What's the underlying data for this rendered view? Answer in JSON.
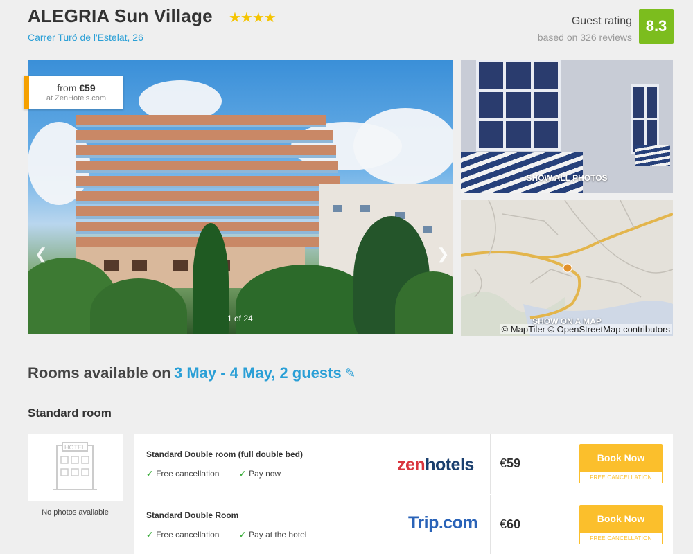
{
  "hotel": {
    "name": "ALEGRIA Sun Village",
    "stars": "★★★★",
    "star_count": 4,
    "address": "Carrer Turó de l'Estelat, 26"
  },
  "rating": {
    "label": "Guest rating",
    "sub": "based on 326 reviews",
    "score": "8.3",
    "color": "#7cbd1e"
  },
  "gallery": {
    "from_label": "from",
    "from_price": "€59",
    "from_source": "at ZenHotels.com",
    "prev_icon": "chevron-left-icon",
    "next_icon": "chevron-right-icon",
    "counter": "1 of 24",
    "show_all_photos": "SHOW ALL PHOTOS",
    "show_on_map": "SHOW ON A MAP",
    "map_credit": "© MapTiler © OpenStreetMap contributors"
  },
  "rooms": {
    "heading": "Rooms available on",
    "dates": "3 May - 4 May, 2 guests",
    "edit_icon": "pencil-icon",
    "room_type": "Standard room",
    "no_photos": "No photos available",
    "placeholder_sign": "HOTEL",
    "offers": [
      {
        "name": "Standard Double room (full double bed)",
        "perks": [
          "Free cancellation",
          "Pay now"
        ],
        "provider_part1": "zen",
        "provider_part2": "hotels",
        "currency": "€",
        "price": "59",
        "book_label": "Book Now",
        "book_sub": "FREE CANCELLATION"
      },
      {
        "name": "Standard Double Room",
        "perks": [
          "Free cancellation",
          "Pay at the hotel"
        ],
        "provider": "Trip.com",
        "currency": "€",
        "price": "60",
        "book_label": "Book Now",
        "book_sub": "FREE CANCELLATION"
      }
    ]
  },
  "colors": {
    "accent_blue": "#2a9fd6",
    "book_yellow": "#fbbf2c",
    "badge_orange": "#f5a000",
    "check_green": "#3fae3f"
  }
}
